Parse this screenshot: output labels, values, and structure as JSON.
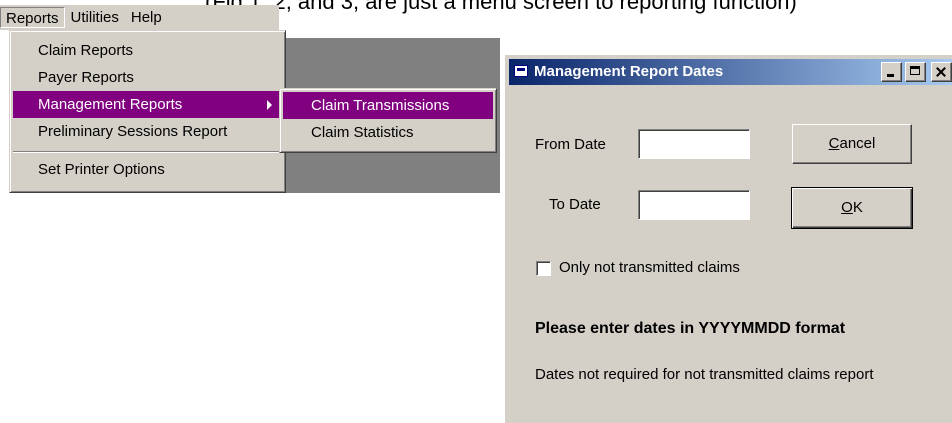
{
  "top_caption": "(Fig.1, 2, and 3, are just a menu screen to reporting function)",
  "menubar": {
    "items": [
      {
        "label": "Reports"
      },
      {
        "label": "Utilities"
      },
      {
        "label": "Help"
      }
    ]
  },
  "reports_menu": {
    "items": [
      {
        "label": "Claim Reports"
      },
      {
        "label": "Payer Reports"
      },
      {
        "label": "Management Reports"
      },
      {
        "label": "Preliminary Sessions Report"
      },
      {
        "label": "Set Printer Options"
      }
    ]
  },
  "management_submenu": {
    "items": [
      {
        "label": "Claim Transmissions"
      },
      {
        "label": "Claim Statistics"
      }
    ]
  },
  "dialog": {
    "title": "Management Report Dates",
    "from_label": "From Date",
    "from_value": "",
    "to_label": "To Date",
    "to_value": "",
    "cancel_accel": "C",
    "cancel_rest": "ancel",
    "ok_accel": "O",
    "ok_rest": "K",
    "checkbox_label": "Only not transmitted claims",
    "instruction": "Please enter dates in YYYYMMDD format",
    "note": "Dates not required for not transmitted claims report"
  },
  "colors": {
    "menu_highlight": "#800080",
    "title_gradient_start": "#0a246a",
    "title_gradient_end": "#a6caf0",
    "face": "#d4d0c8"
  }
}
